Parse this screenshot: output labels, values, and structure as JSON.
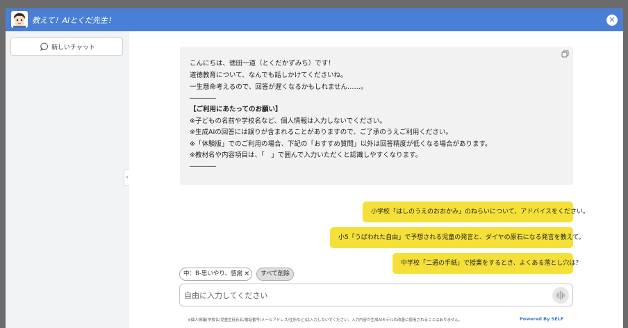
{
  "app": {
    "title": "教えて！AIとくだ先生！",
    "close_icon": "close-icon"
  },
  "sidebar": {
    "new_chat_label": "新しいチャット",
    "new_chat_icon": "chat-bubble-icon",
    "collapse_label": "‹"
  },
  "bot_message": {
    "lines": [
      "こんにちは、徳田一道（とくだかずみち）です！",
      "道徳教育について、なんでも話しかけてくださいね。",
      "一生懸命考えるので、回答が遅くなるかもしれません……。",
      "――――",
      "【ご利用にあたってのお願い】",
      "※子どもの名前や学校名など、個人情報は入力しないでください。",
      "※生成AIの回答には誤りが含まれることがありますので、ご了承のうえご利用ください。",
      "※「体験版」でのご利用の場合、下記の「おすすめ質問」以外は回答精度が低くなる場合があります。",
      "※教材名や内容項目は、「　」で囲んで入力いただくと認識しやすくなります。",
      "――――"
    ],
    "copy_icon": "copy-icon"
  },
  "suggested_questions": [
    "小学校「はしのうえのおおかみ」のねらいについて、アドバイスをください。",
    "小5「うばわれた自由」で予想される児童の発言と、ダイヤの原石になる発言を教えて。",
    "中学校「二通の手紙」で授業をするとき、よくある落とし穴は？"
  ],
  "filters": {
    "tag_label": "中：B-思いやり、感謝",
    "tag_remove": "✕",
    "clear_all_label": "すべて削除"
  },
  "input": {
    "placeholder": "自由に入力してください",
    "value": "",
    "mic_icon": "voice-input-icon"
  },
  "footer": {
    "disclaimer": "※個人情報(学校名/児童生徒氏名/電話番号/メールアドレス/住所など)は入力しないでください。入力内容が生成AIモデルの改善に使用されることはありません。",
    "powered_by": "Powered By SELF"
  },
  "colors": {
    "titlebar": "#4a7fd6",
    "user_bubble": "#f5e03a",
    "bot_bubble": "#f2f2f2",
    "link": "#3a72d1"
  }
}
